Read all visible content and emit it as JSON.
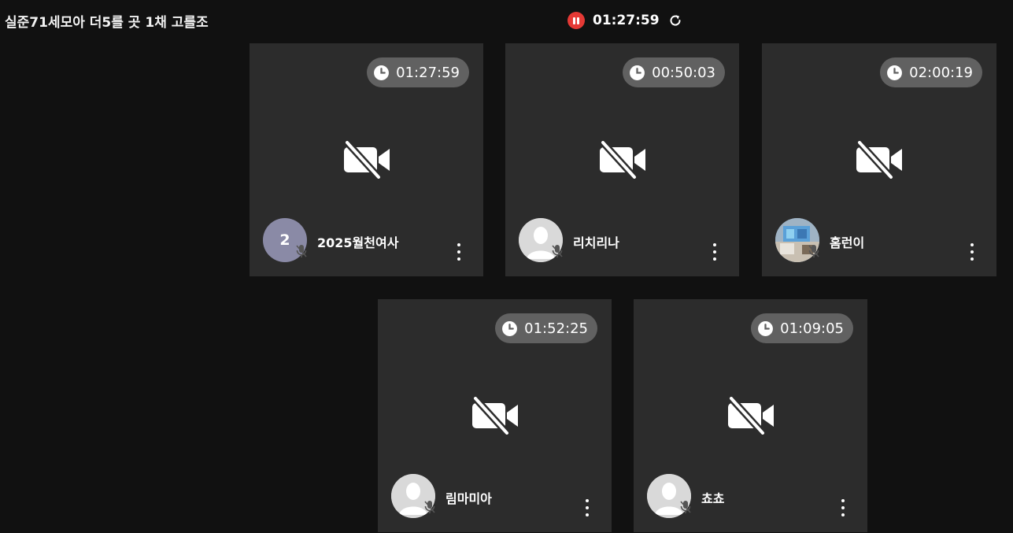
{
  "room": {
    "title": "실준71세모아 더5를 곳 1채 고를조"
  },
  "recording": {
    "time": "01:27:59",
    "status_color": "#e53935"
  },
  "participants": [
    {
      "timer": "01:27:59",
      "name": "2025월천여사",
      "avatar": "initial",
      "initial": "2",
      "camera": "off",
      "mic": "off"
    },
    {
      "timer": "00:50:03",
      "name": "리치리나",
      "avatar": "person",
      "camera": "off",
      "mic": "off"
    },
    {
      "timer": "02:00:19",
      "name": "홈런이",
      "avatar": "photo",
      "camera": "off",
      "mic": "off"
    },
    {
      "timer": "01:52:25",
      "name": "림마미아",
      "avatar": "person",
      "camera": "off",
      "mic": "off"
    },
    {
      "timer": "01:09:05",
      "name": "쵸쵸",
      "avatar": "person",
      "camera": "off",
      "mic": "off"
    }
  ]
}
